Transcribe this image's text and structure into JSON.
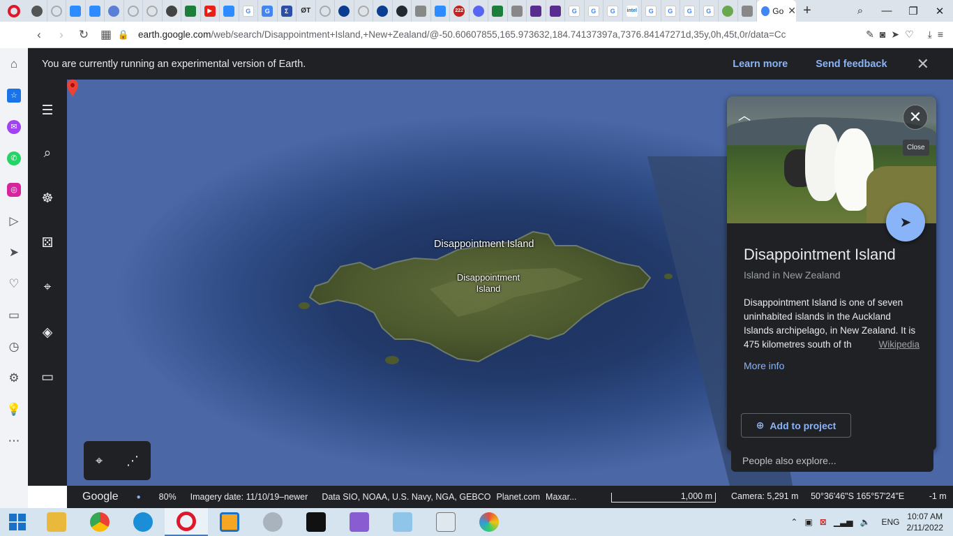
{
  "browser": {
    "active_tab_title": "Go",
    "url_host": "earth.google.com",
    "url_path": "/web/search/Disappointment+Island,+New+Zealand/@-50.60607855,165.973632,184.74137397a,7376.84147271d,35y,0h,45t,0r/data=Cc",
    "badge_count": "222"
  },
  "banner": {
    "message": "You are currently running an experimental version of Earth.",
    "learn_more": "Learn more",
    "send_feedback": "Send feedback"
  },
  "map": {
    "label_main": "Disappointment Island",
    "label_pin_line1": "Disappointment",
    "label_pin_line2": "Island"
  },
  "status": {
    "brand": "Google",
    "zoom": "80%",
    "imagery_date": "Imagery date: 11/10/19–newer",
    "data_sources": "Data SIO, NOAA, U.S. Navy, NGA, GEBCO",
    "planet": "Planet.com",
    "maxar": "Maxar...",
    "scale": "1,000 m",
    "camera": "Camera: 5,291 m",
    "coords": "50°36'46\"S 165°57'24\"E",
    "elevation": "-1 m"
  },
  "card": {
    "title": "Disappointment Island",
    "subtitle": "Island in New Zealand",
    "description": "Disappointment Island is one of seven uninhabited islands in the Auckland Islands archipelago, in New Zealand. It is 475 kilometres south of th",
    "source": "Wikipedia",
    "more_info": "More info",
    "close_tooltip": "Close",
    "add_to_project": "Add to project",
    "people_also_explore": "People also explore..."
  },
  "taskbar": {
    "language": "ENG",
    "time": "10:07 AM",
    "date": "2/11/2022"
  },
  "colors": {
    "accent": "#8ab4f8",
    "earth_dark": "#202124",
    "opera_red": "#e0172b"
  }
}
